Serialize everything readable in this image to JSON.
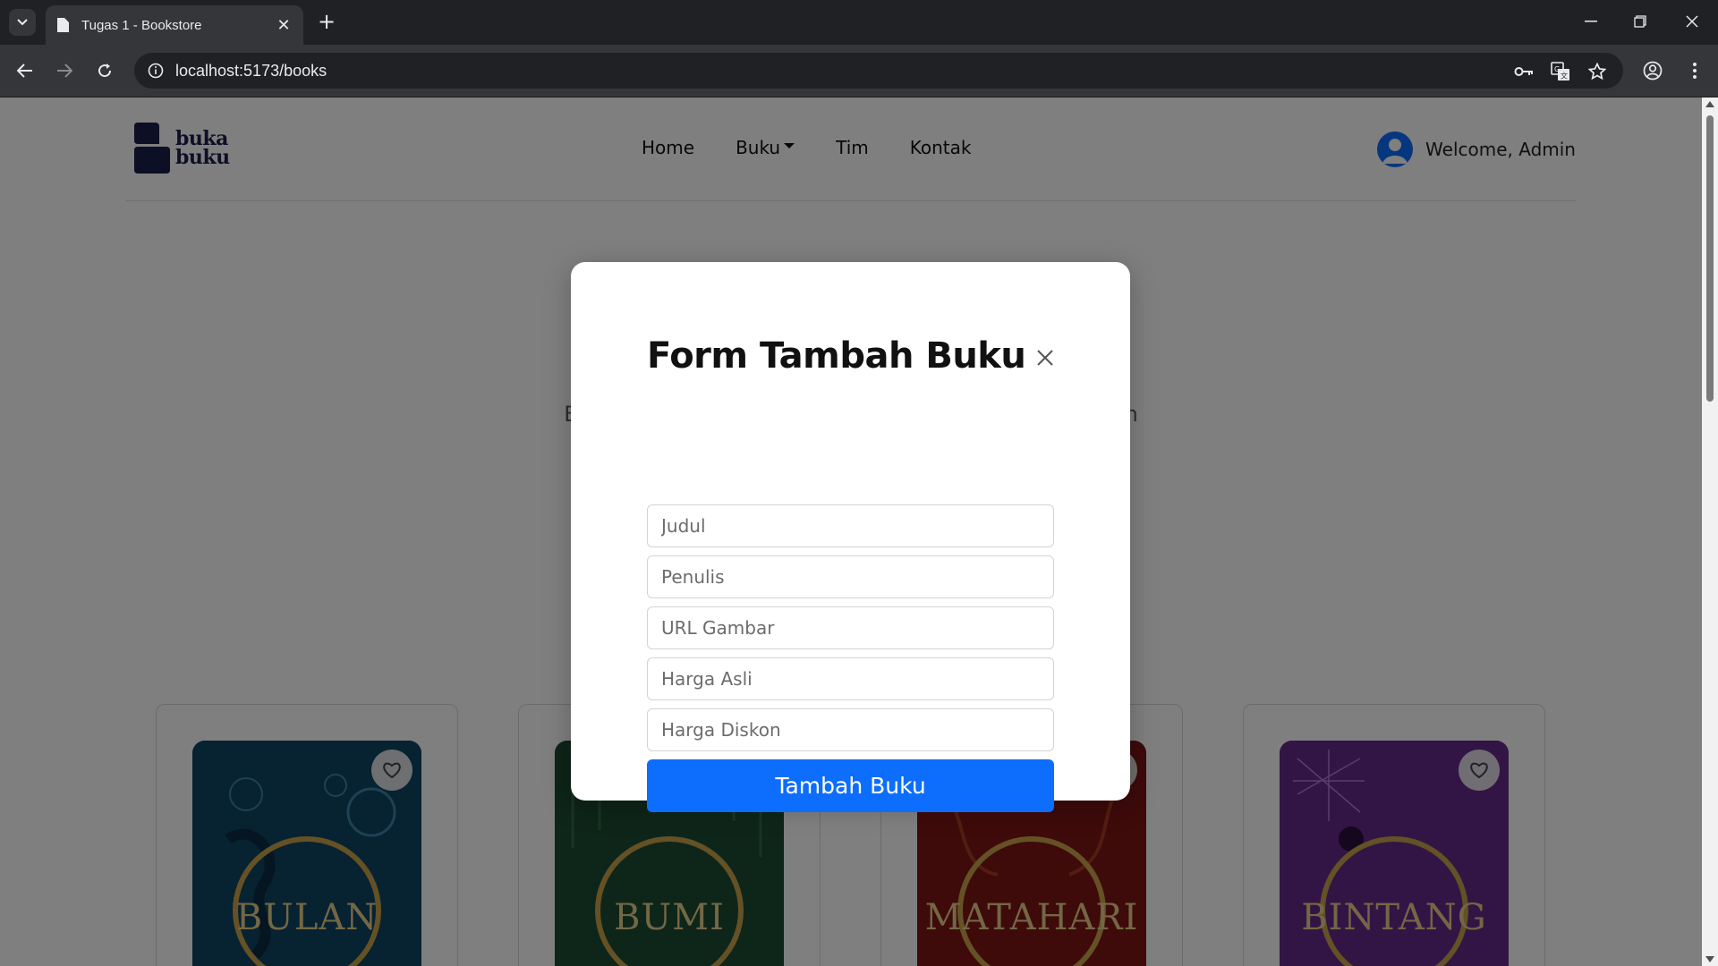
{
  "browser": {
    "tab_title": "Tugas 1 - Bookstore",
    "url": "localhost:5173/books"
  },
  "site": {
    "logo_line1": "buka",
    "logo_line2": "buku",
    "nav": [
      {
        "label": "Home"
      },
      {
        "label": "Buku",
        "has_dropdown": true
      },
      {
        "label": "Tim"
      },
      {
        "label": "Kontak"
      }
    ],
    "welcome": "Welcome, Admin",
    "hero_subtitle_left": "Bu",
    "hero_subtitle_right": "ah"
  },
  "books": [
    {
      "title": "BULAN",
      "color": "#0f4a6b"
    },
    {
      "title": "BUMI",
      "color": "#1f4f35"
    },
    {
      "title": "MATAHARI",
      "color": "#8a1616"
    },
    {
      "title": "BINTANG",
      "color": "#6a2a8e"
    }
  ],
  "modal": {
    "title": "Form Tambah Buku",
    "fields": {
      "judul": "Judul",
      "penulis": "Penulis",
      "url_gambar": "URL Gambar",
      "harga_asli": "Harga Asli",
      "harga_diskon": "Harga Diskon"
    },
    "submit_label": "Tambah Buku"
  },
  "colors": {
    "primary": "#0d6efd",
    "logo": "#1b1f4b",
    "backdrop": "rgba(0,0,0,0.5)"
  }
}
